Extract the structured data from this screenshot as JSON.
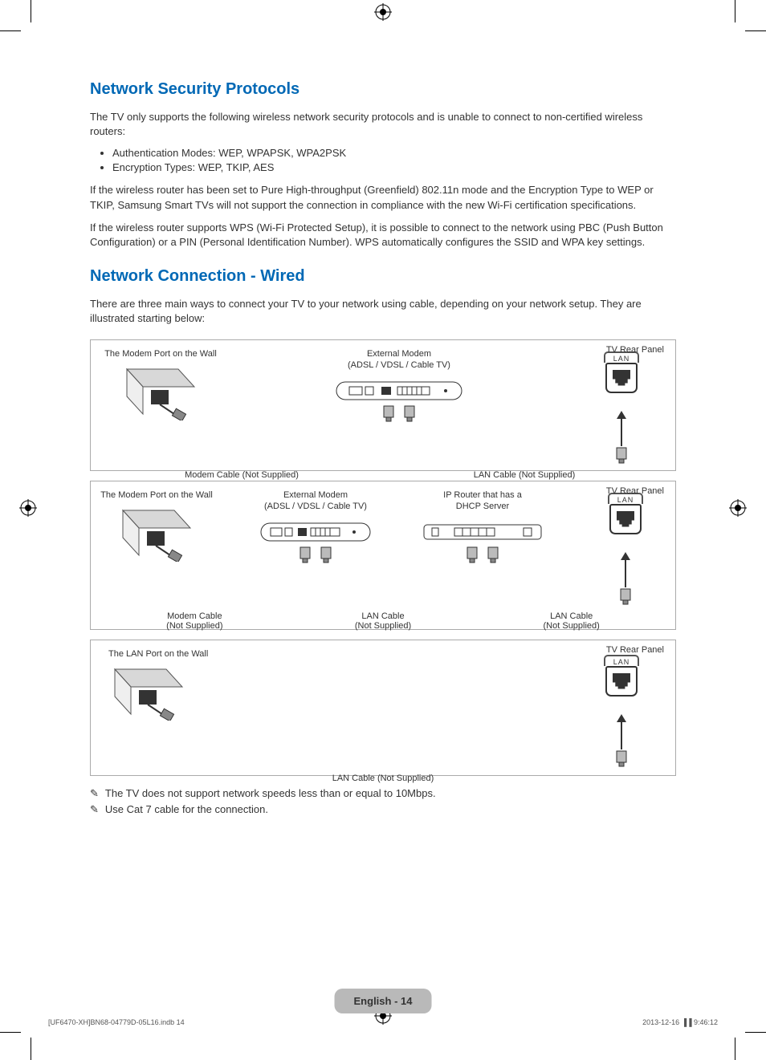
{
  "section1": {
    "heading": "Network Security Protocols",
    "intro": "The TV only supports the following wireless network security protocols and is unable to connect to non-certified wireless routers:",
    "bullets": [
      "Authentication Modes: WEP, WPAPSK, WPA2PSK",
      "Encryption Types: WEP, TKIP, AES"
    ],
    "para2": "If the wireless router has been set to Pure High-throughput (Greenfield) 802.11n mode and the Encryption Type to WEP or TKIP, Samsung Smart TVs will not support the connection in compliance with the new Wi-Fi certification specifications.",
    "para3": "If the wireless router supports WPS (Wi-Fi Protected Setup), it is possible to connect to the network using PBC (Push Button Configuration) or a PIN (Personal Identification Number). WPS automatically configures the SSID and WPA key settings."
  },
  "section2": {
    "heading": "Network Connection - Wired",
    "intro": "There are three main ways to connect your TV to your network using cable, depending on your network setup. They are illustrated starting below:"
  },
  "diag_labels": {
    "tv_rear_panel": "TV Rear Panel",
    "modem_port_wall": "The Modem Port on the Wall",
    "lan_port_wall": "The LAN Port on the Wall",
    "external_modem": "External Modem",
    "external_modem_sub": "(ADSL / VDSL / Cable TV)",
    "ip_router": "IP Router that has a",
    "ip_router_sub": "DHCP Server",
    "lan_tag": "LAN",
    "modem_cable_ns": "Modem Cable (Not Supplied)",
    "lan_cable_ns": "LAN Cable (Not Supplied)",
    "modem_cable": "Modem Cable",
    "not_supplied": "(Not Supplied)",
    "lan_cable": "LAN Cable"
  },
  "notes": {
    "n1": "The TV does not support network speeds less than or equal to 10Mbps.",
    "n2": "Use Cat 7 cable for the connection.",
    "icon": "✎"
  },
  "footer": {
    "pill": "English - 14",
    "left": "[UF6470-XH]BN68-04779D-05L16.indb   14",
    "right_date": "2013-12-16   ",
    "right_time": "9:46:12"
  }
}
